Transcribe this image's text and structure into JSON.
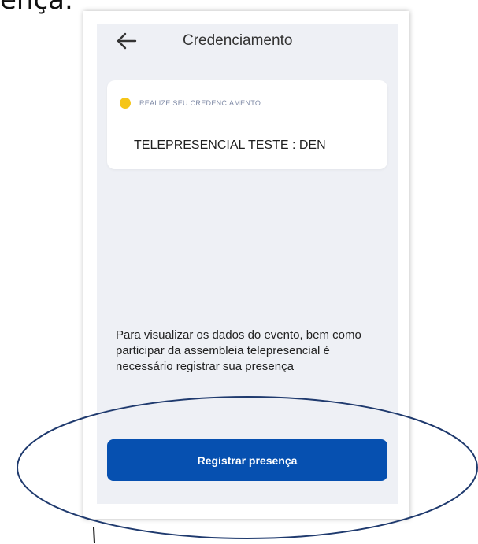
{
  "caption": {
    "text": "ença."
  },
  "header": {
    "back_icon": "arrow-left-icon",
    "title": "Credenciamento"
  },
  "card": {
    "status_label": "REALIZE SEU CREDENCIAMENTO",
    "status_color": "#f5c518",
    "event_name": "TELEPRESENCIAL TESTE : DEN"
  },
  "info": {
    "text": "Para visualizar os dados do evento, bem como participar da assembleia telepresencial é necessário registrar sua presença"
  },
  "register_button": {
    "label": "Registrar presença",
    "color": "#0650b0"
  },
  "annotation": {
    "ellipse_color": "#1f3a6e"
  }
}
